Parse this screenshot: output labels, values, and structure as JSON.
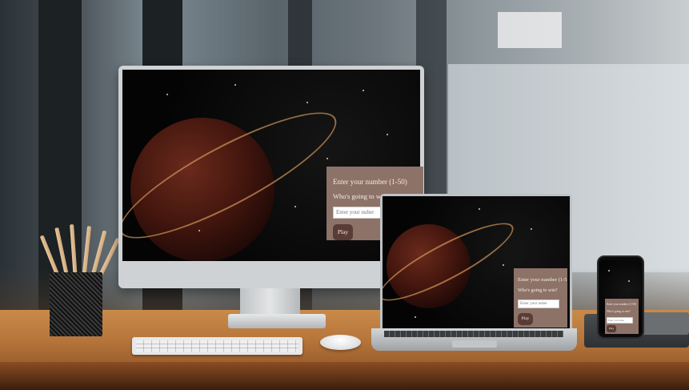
{
  "game": {
    "title": "Enter your number (1-50)",
    "question": "Who's going to win?",
    "input_placeholder": "Enter your nuber",
    "play_label": "Play"
  },
  "laptop_game": {
    "title": "Enter your number (1-5",
    "question": "Who's going to win?",
    "input_placeholder": "Enter your nuber",
    "play_label": "Play"
  },
  "phone_game": {
    "title": "Enter your number (1-50)",
    "question": "Who's going to win?",
    "input_placeholder": "Enter your nuber",
    "play_label": "Play"
  },
  "colors": {
    "panel_bg": "#8d7268",
    "button_bg": "#5a3c37",
    "screen_bg": "#050505"
  },
  "icons": [
    "planet-icon",
    "star-icon"
  ]
}
